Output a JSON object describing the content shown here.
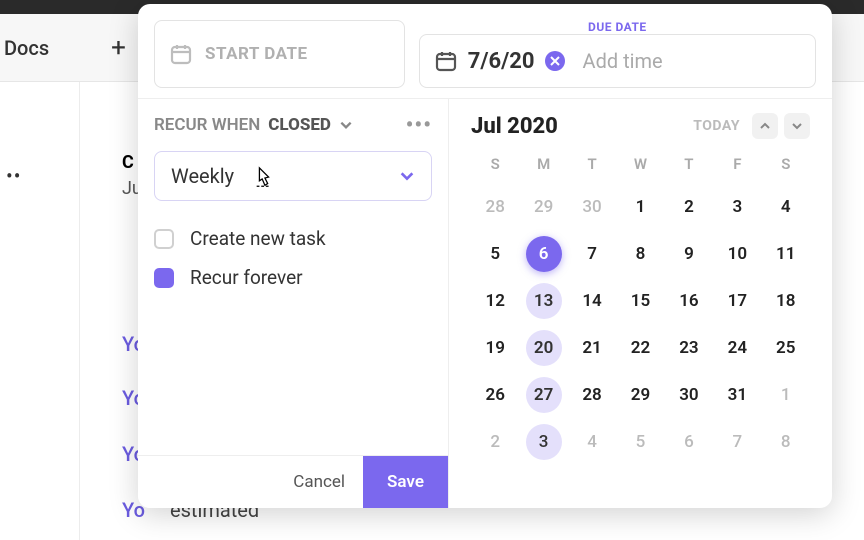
{
  "background": {
    "nav_docs": "Docs",
    "dots": "••",
    "c": "C",
    "j": "Ju",
    "you1": "Yo",
    "you2": "Yo",
    "you3": "Yo",
    "you4": "Yo",
    "estimated": "estimated"
  },
  "modal": {
    "start_label": "START DATE",
    "due_title": "DUE DATE",
    "due_value": "7/6/20",
    "add_time": "Add time",
    "recur_label": "RECUR WHEN",
    "recur_state": "CLOSED",
    "dropdown": "Weekly",
    "cb_create": "Create new task",
    "cb_forever": "Recur forever",
    "cancel": "Cancel",
    "save": "Save"
  },
  "calendar": {
    "month": "Jul 2020",
    "today": "TODAY",
    "dow": [
      "S",
      "M",
      "T",
      "W",
      "T",
      "F",
      "S"
    ],
    "cells": [
      {
        "n": 28,
        "out": true
      },
      {
        "n": 29,
        "out": true
      },
      {
        "n": 30,
        "out": true
      },
      {
        "n": 1
      },
      {
        "n": 2
      },
      {
        "n": 3
      },
      {
        "n": 4
      },
      {
        "n": 5
      },
      {
        "n": 6,
        "selected": true
      },
      {
        "n": 7
      },
      {
        "n": 8
      },
      {
        "n": 9
      },
      {
        "n": 10
      },
      {
        "n": 11
      },
      {
        "n": 12
      },
      {
        "n": 13,
        "recur": true
      },
      {
        "n": 14
      },
      {
        "n": 15
      },
      {
        "n": 16
      },
      {
        "n": 17
      },
      {
        "n": 18
      },
      {
        "n": 19
      },
      {
        "n": 20,
        "recur": true
      },
      {
        "n": 21
      },
      {
        "n": 22
      },
      {
        "n": 23
      },
      {
        "n": 24
      },
      {
        "n": 25
      },
      {
        "n": 26
      },
      {
        "n": 27,
        "recur": true
      },
      {
        "n": 28
      },
      {
        "n": 29
      },
      {
        "n": 30
      },
      {
        "n": 31
      },
      {
        "n": 1,
        "out": true
      },
      {
        "n": 2,
        "out": true
      },
      {
        "n": 3,
        "recur": true,
        "out": true
      },
      {
        "n": 4,
        "out": true
      },
      {
        "n": 5,
        "out": true
      },
      {
        "n": 6,
        "out": true
      },
      {
        "n": 7,
        "out": true
      },
      {
        "n": 8,
        "out": true
      }
    ]
  }
}
